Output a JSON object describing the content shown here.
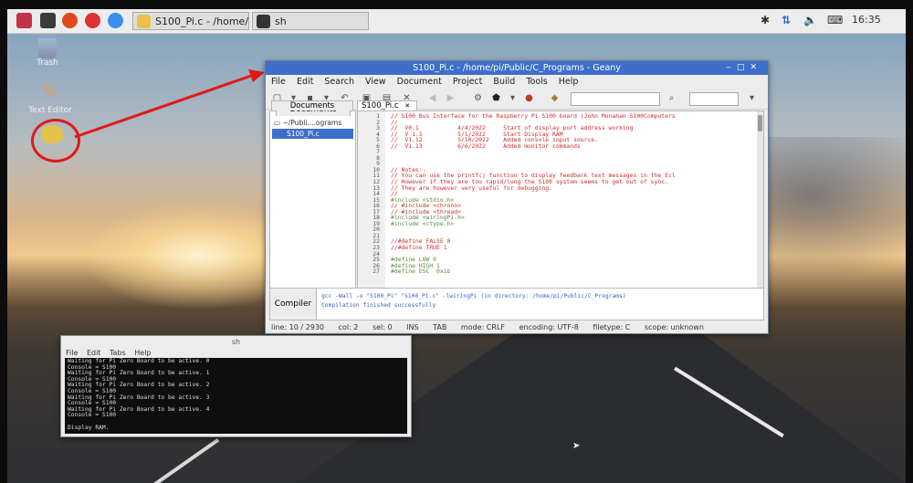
{
  "panel": {
    "tasks": [
      {
        "label": "S100_Pi.c - /home/pi..."
      },
      {
        "label": "sh"
      }
    ],
    "clock": "16:35"
  },
  "desktop": {
    "icons": [
      {
        "label": "Trash"
      },
      {
        "label": "Text Editor"
      },
      {
        "label": ""
      }
    ]
  },
  "geany": {
    "title": "S100_Pi.c - /home/pi/Public/C_Programs - Geany",
    "menu": [
      "File",
      "Edit",
      "Search",
      "View",
      "Document",
      "Project",
      "Build",
      "Tools",
      "Help"
    ],
    "sidebar": {
      "tab": "Documents",
      "folder": "~/Publi....ograms",
      "file": "S100_Pi.c"
    },
    "editor_tab": "S100_Pi.c",
    "code": [
      {
        "n": "1",
        "t": "// S100 Bus Interface for the Raspberry Pi S100 board (John Monahan S100Computers",
        "k": "cm"
      },
      {
        "n": "2",
        "t": "//",
        "k": "cm"
      },
      {
        "n": "3",
        "t": "//  V0.1           4/4/2022     Start of display port address working",
        "k": "cm"
      },
      {
        "n": "4",
        "t": "//  V 1.1          5/1/2022     Start Display RAM",
        "k": "cm"
      },
      {
        "n": "5",
        "t": "//  V1.12          5/10/2022    Added console input source.",
        "k": "cm"
      },
      {
        "n": "6",
        "t": "//  V1.13          6/6/2022     Added monitor commands",
        "k": "cm"
      },
      {
        "n": "7",
        "t": "",
        "k": "pl"
      },
      {
        "n": "8",
        "t": "",
        "k": "pl"
      },
      {
        "n": "9",
        "t": "",
        "k": "pl"
      },
      {
        "n": "10",
        "t": "// Notes:-",
        "k": "cm"
      },
      {
        "n": "11",
        "t": "// You can use the printf() function to display feedback text messages in the Ecl",
        "k": "cm"
      },
      {
        "n": "12",
        "t": "// However if they are too rapid/long the S100 system seems to get out of sync.",
        "k": "cm"
      },
      {
        "n": "13",
        "t": "// They are however very useful for debugging.",
        "k": "cm"
      },
      {
        "n": "14",
        "t": "//",
        "k": "cm"
      },
      {
        "n": "15",
        "t": "#include <stdio.h>",
        "k": "pp"
      },
      {
        "n": "16",
        "t": "// #include <chrono>",
        "k": "cm"
      },
      {
        "n": "17",
        "t": "// #include <thread>",
        "k": "cm"
      },
      {
        "n": "18",
        "t": "#include <wiringPi.h>",
        "k": "pp"
      },
      {
        "n": "19",
        "t": "#include <ctype.h>",
        "k": "pp"
      },
      {
        "n": "20",
        "t": "",
        "k": "pl"
      },
      {
        "n": "21",
        "t": "",
        "k": "pl"
      },
      {
        "n": "22",
        "t": "//#define FALSE 0",
        "k": "cm"
      },
      {
        "n": "23",
        "t": "//#define TRUE 1",
        "k": "cm"
      },
      {
        "n": "24",
        "t": "",
        "k": "pl"
      },
      {
        "n": "25",
        "t": "#define LOW 0",
        "k": "pp"
      },
      {
        "n": "26",
        "t": "#define HIGH 1",
        "k": "pp"
      },
      {
        "n": "27",
        "t": "#define ESC  0x1b",
        "k": "pp"
      }
    ],
    "compiler_tab": "Compiler",
    "messages": [
      "gcc -Wall -o \"S100_Pi\" \"S100_Pi.c\" -lwiringPi (in directory: /home/pi/Public/C_Programs)",
      "Compilation finished successfully"
    ],
    "status": [
      "line: 10 / 2930",
      "col: 2",
      "sel: 0",
      "INS",
      "TAB",
      "mode: CRLF",
      "encoding: UTF-8",
      "filetype: C",
      "scope: unknown"
    ]
  },
  "terminal": {
    "title": "sh",
    "menu": [
      "File",
      "Edit",
      "Tabs",
      "Help"
    ],
    "lines": [
      "Waiting for Pi Zero Board to be active. 0",
      "Console = S100",
      "Waiting for Pi Zero Board to be active. 1",
      "Console = S100",
      "Waiting for Pi Zero Board to be active. 2",
      "Console = S100",
      "Waiting for Pi Zero Board to be active. 3",
      "Console = S100",
      "Waiting for Pi Zero Board to be active. 4",
      "Console = S100",
      "",
      "Display RAM."
    ]
  },
  "colors": {
    "annotation": "#e01818",
    "titlebar": "#3d6ec9"
  }
}
